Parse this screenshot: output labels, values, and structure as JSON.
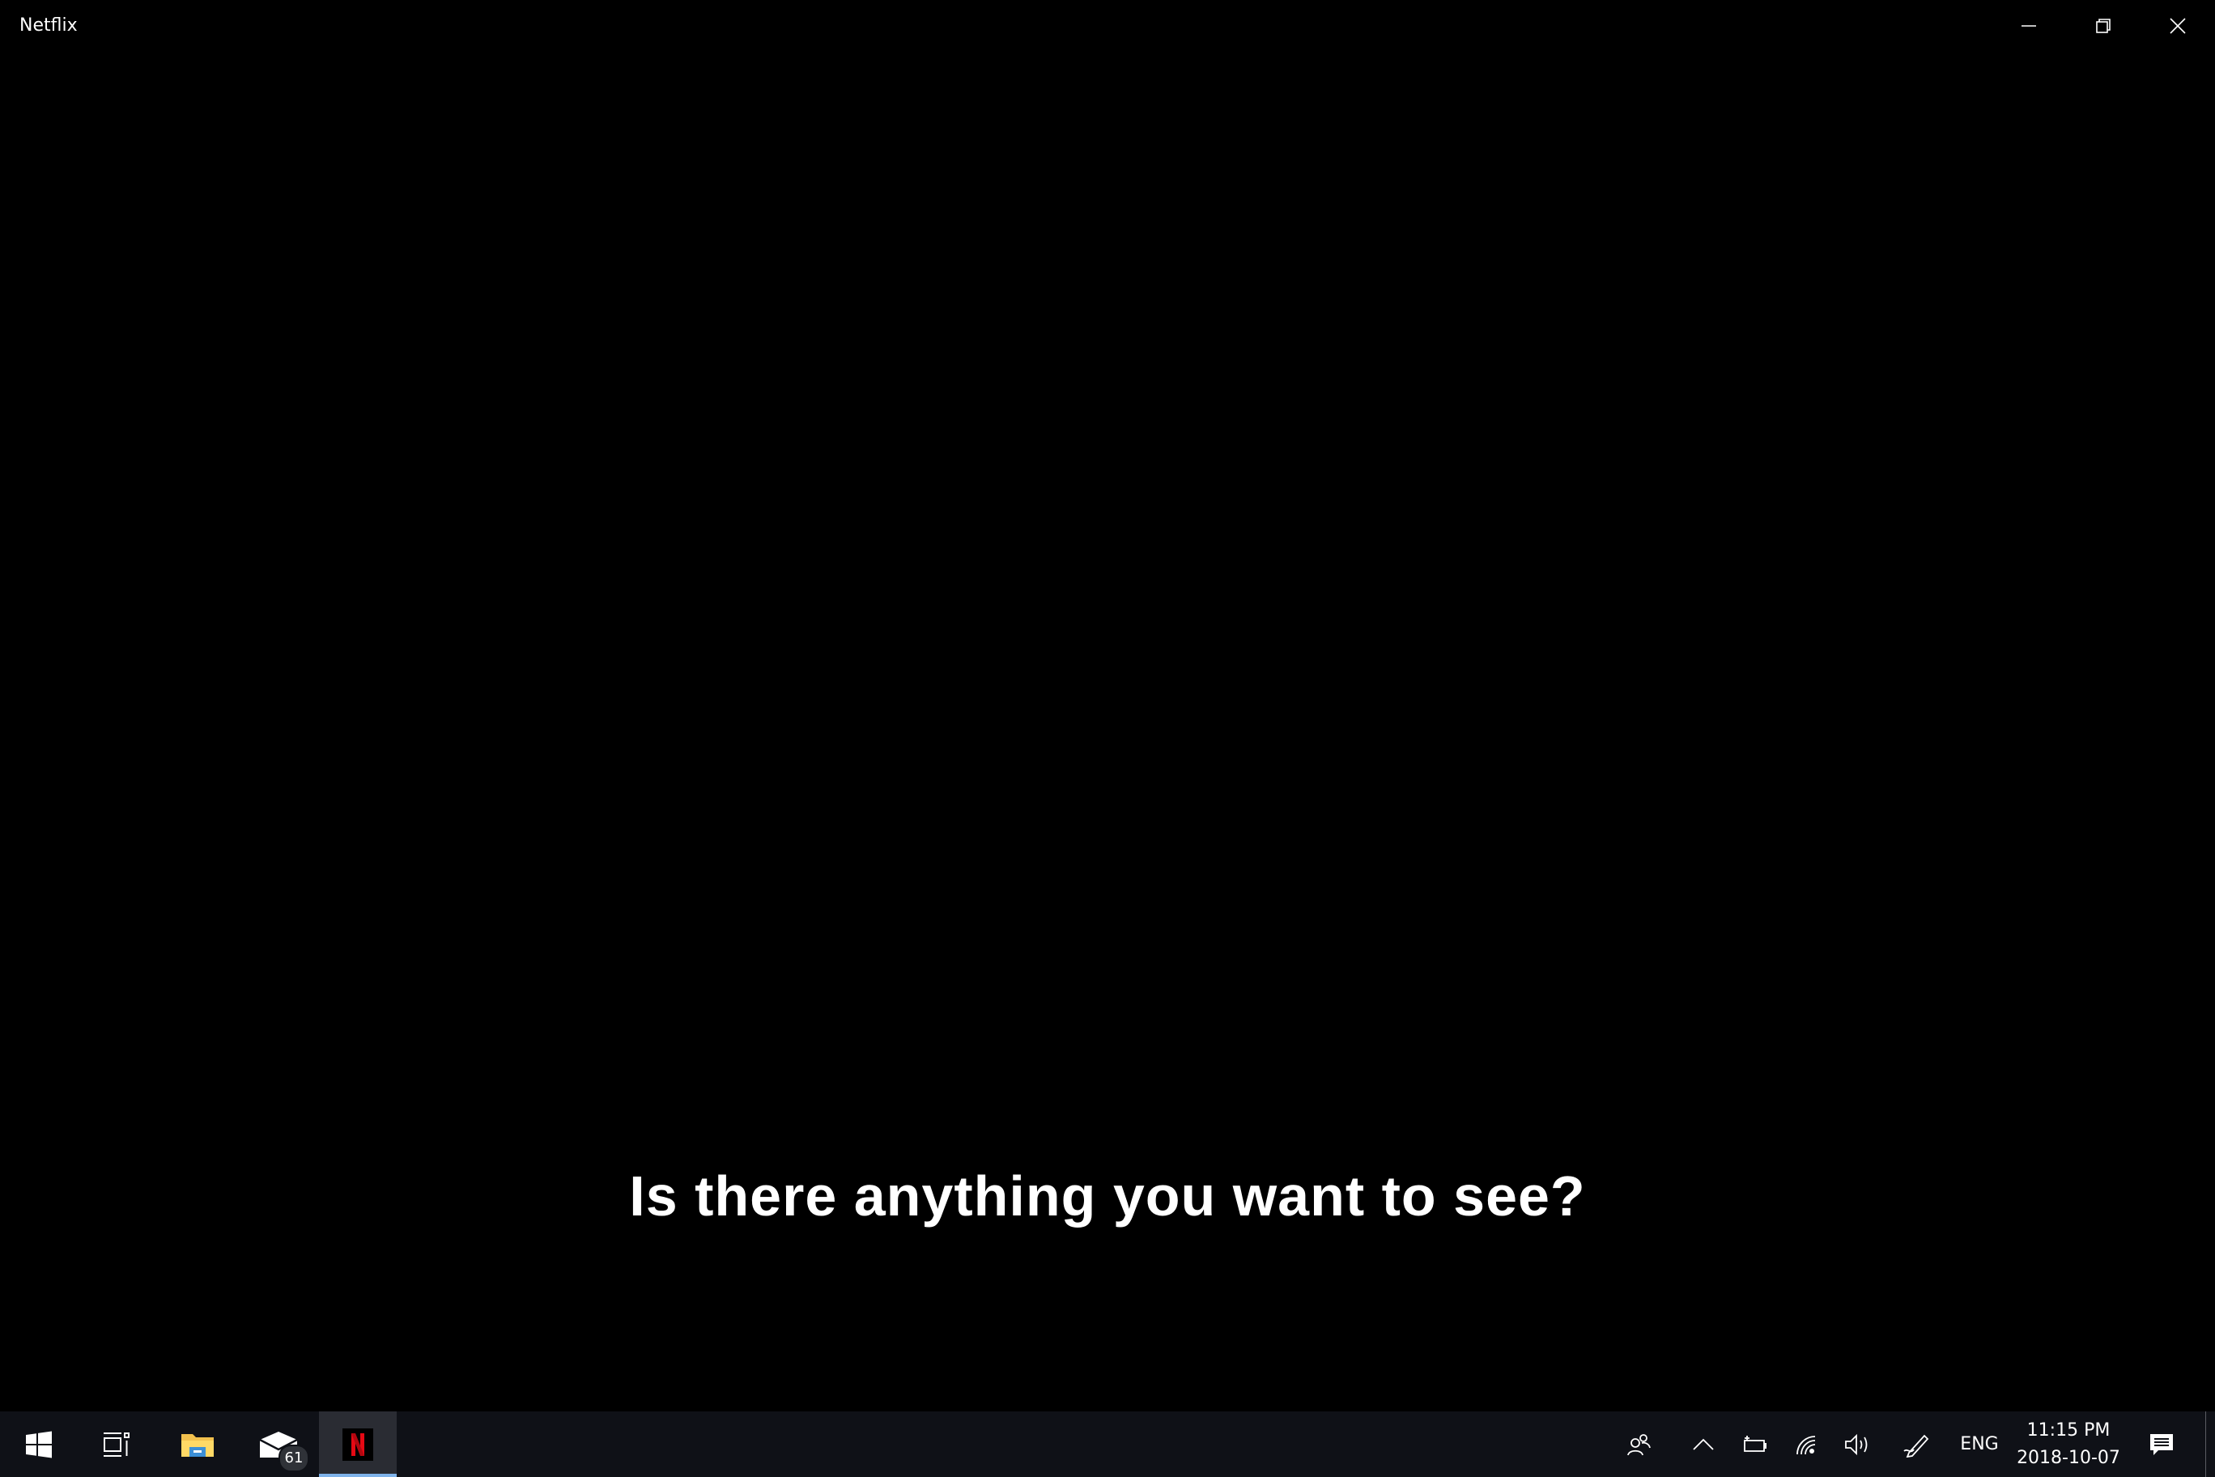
{
  "window": {
    "title": "Netflix",
    "controls": {
      "minimize": "minimize-icon",
      "maximize": "restore-icon",
      "close": "close-icon"
    }
  },
  "player": {
    "subtitle": "Is there anything you want to see?"
  },
  "taskbar": {
    "apps": [
      {
        "name": "Start",
        "icon": "windows-logo-icon"
      },
      {
        "name": "Task View",
        "icon": "task-view-icon"
      },
      {
        "name": "File Explorer",
        "icon": "folder-icon"
      },
      {
        "name": "Mail",
        "icon": "mail-icon",
        "badge": "61"
      },
      {
        "name": "Netflix",
        "icon": "netflix-icon",
        "logo_letter": "N",
        "active": true
      }
    ],
    "tray": {
      "language": "ENG",
      "time": "11:15 PM",
      "date": "2018-10-07"
    }
  },
  "colors": {
    "background": "#000000",
    "taskbar": "#0f1117",
    "netflix_red": "#e50914",
    "active_indicator": "#7fb3ea",
    "folder_yellow": "#f2c14e"
  }
}
